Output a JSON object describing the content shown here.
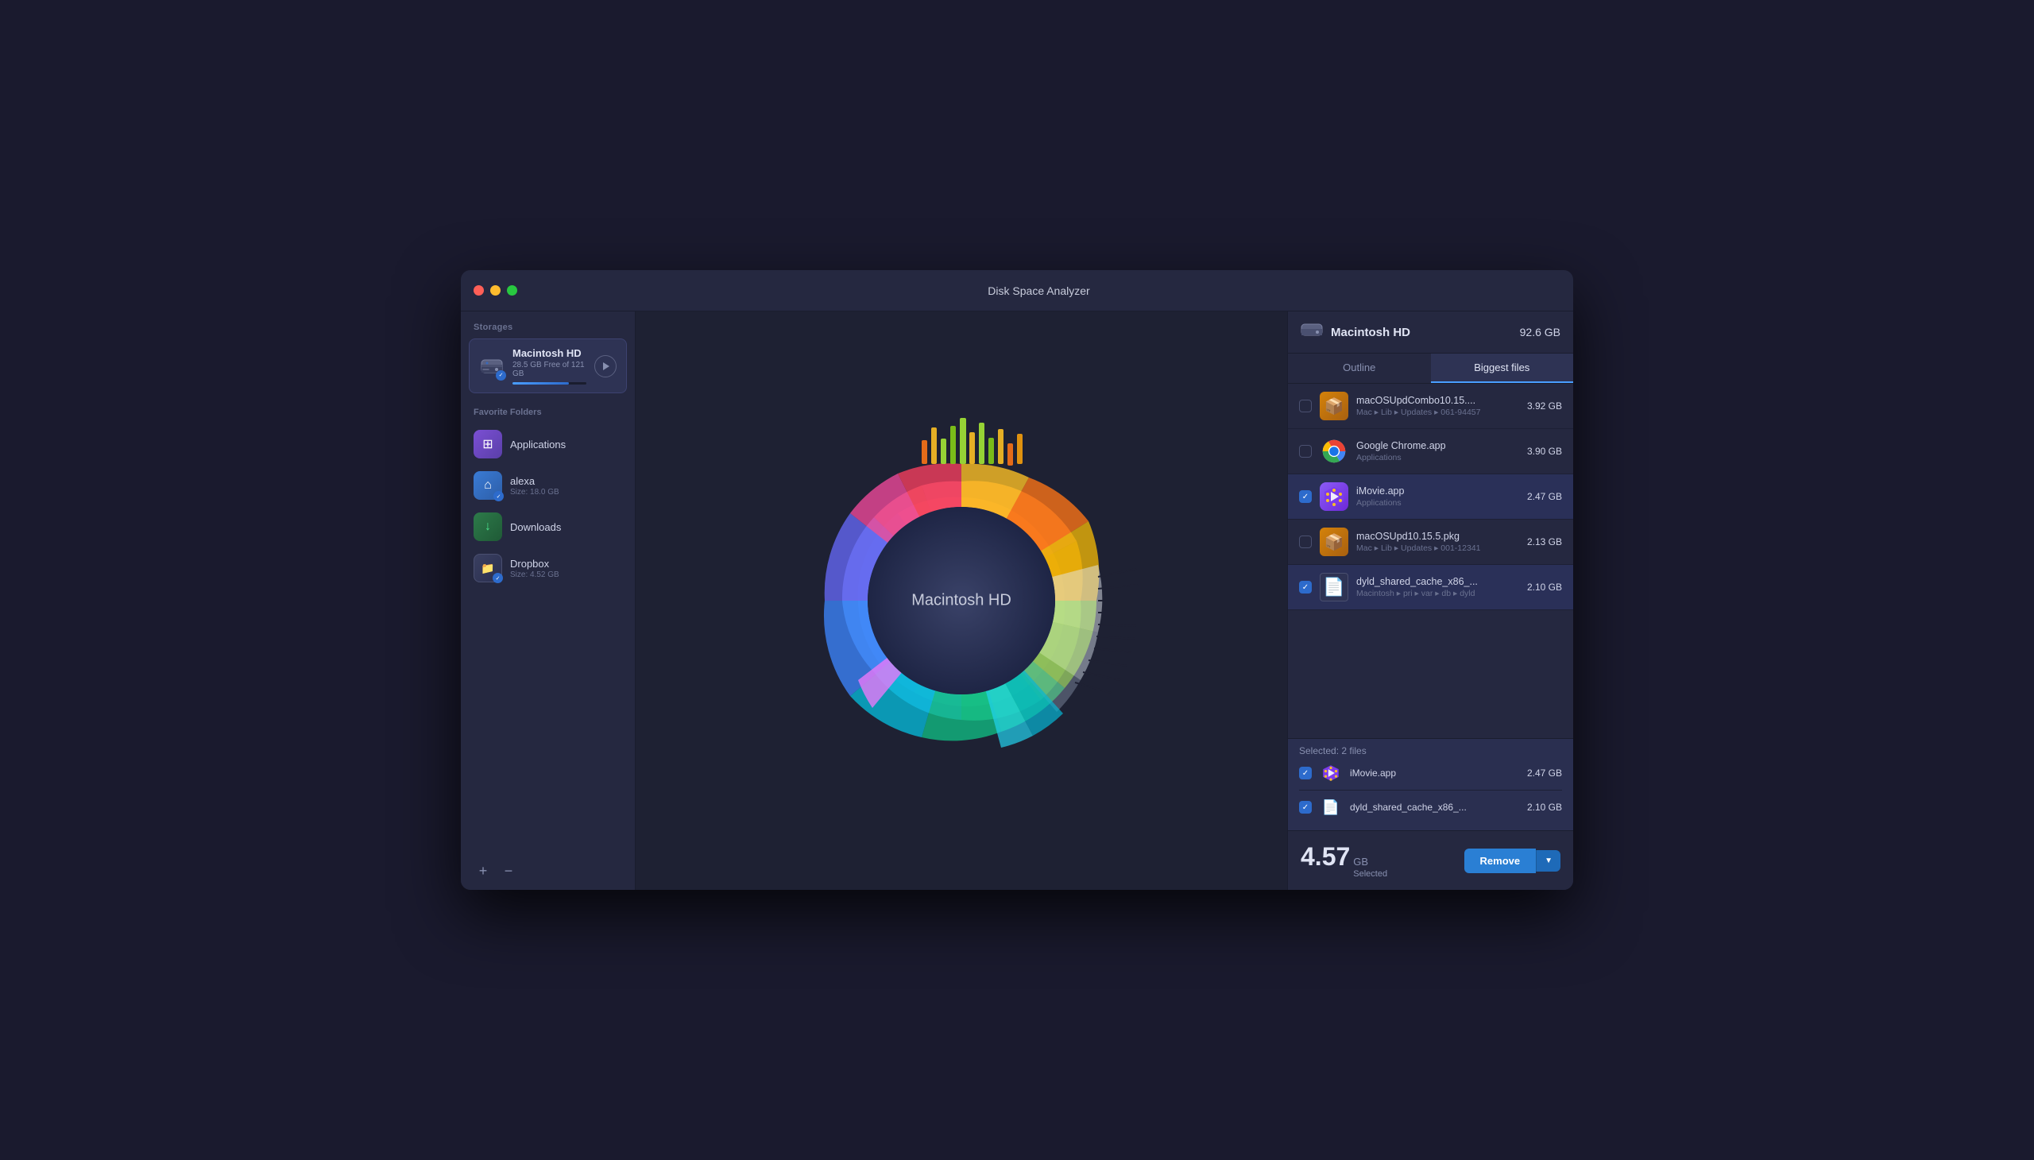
{
  "window": {
    "title": "Disk Space Analyzer"
  },
  "sidebar": {
    "storages_label": "Storages",
    "storage": {
      "name": "Macintosh HD",
      "size_info": "28.5 GB Free of 121 GB",
      "fill_pct": 76
    },
    "favorites_label": "Favorite Folders",
    "favorites": [
      {
        "id": "applications",
        "name": "Applications",
        "subname": "",
        "icon_type": "apps",
        "has_badge": false
      },
      {
        "id": "alexa",
        "name": "alexa",
        "subname": "Size: 18.0 GB",
        "icon_type": "home",
        "has_badge": true
      },
      {
        "id": "downloads",
        "name": "Downloads",
        "subname": "",
        "icon_type": "downloads",
        "has_badge": false
      },
      {
        "id": "dropbox",
        "name": "Dropbox",
        "subname": "Size: 4.52 GB",
        "icon_type": "dropbox",
        "has_badge": true
      }
    ],
    "add_label": "+",
    "remove_label": "−"
  },
  "chart": {
    "center_label": "Macintosh HD"
  },
  "right_panel": {
    "header": {
      "title": "Macintosh HD",
      "size": "92.6 GB"
    },
    "tabs": [
      {
        "id": "outline",
        "label": "Outline",
        "active": false
      },
      {
        "id": "biggest-files",
        "label": "Biggest files",
        "active": true
      }
    ],
    "files": [
      {
        "id": "file1",
        "name": "macOSUpdCombo10.15....",
        "path": "Mac ▸ Lib ▸ Updates ▸ 061-94457",
        "size": "3.92 GB",
        "checked": false,
        "icon_type": "pkg"
      },
      {
        "id": "file2",
        "name": "Google Chrome.app",
        "path": "Applications",
        "size": "3.90 GB",
        "checked": false,
        "icon_type": "chrome"
      },
      {
        "id": "file3",
        "name": "iMovie.app",
        "path": "Applications",
        "size": "2.47 GB",
        "checked": true,
        "icon_type": "imovie"
      },
      {
        "id": "file4",
        "name": "macOSUpd10.15.5.pkg",
        "path": "Mac ▸ Lib ▸ Updates ▸ 001-12341",
        "size": "2.13 GB",
        "checked": false,
        "icon_type": "pkg"
      },
      {
        "id": "file5",
        "name": "dyld_shared_cache_x86_...",
        "path": "Macintosh ▸ pri ▸ var ▸ db ▸ dyld",
        "size": "2.10 GB",
        "checked": true,
        "icon_type": "file"
      }
    ],
    "selected_section": {
      "label": "Selected: 2 files",
      "items": [
        {
          "id": "sel1",
          "name": "iMovie.app",
          "size": "2.47 GB",
          "icon_type": "imovie"
        },
        {
          "id": "sel2",
          "name": "dyld_shared_cache_x86_...",
          "size": "2.10 GB",
          "icon_type": "file"
        }
      ]
    },
    "bottom": {
      "total_number": "4.57",
      "total_unit": "GB",
      "total_sub": "Selected",
      "remove_label": "Remove"
    }
  }
}
